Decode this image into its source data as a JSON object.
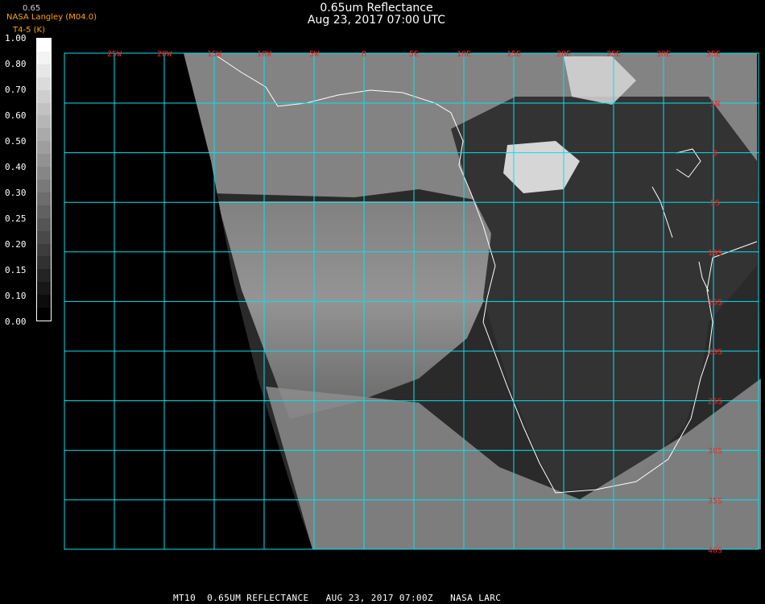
{
  "header": {
    "title": "0.65um Reflectance",
    "subtitle": "Aug 23, 2017 07:00 UTC"
  },
  "credit": {
    "band_label": "0.65",
    "source": "NASA Langley (M04.0)",
    "band_sub": "T4-5 (K)"
  },
  "colorbar": {
    "ticks": [
      "1.00",
      "0.80",
      "0.70",
      "0.60",
      "0.50",
      "0.40",
      "0.30",
      "0.25",
      "0.20",
      "0.15",
      "0.10",
      "0.00"
    ]
  },
  "map": {
    "lon_labels": [
      "25W",
      "20W",
      "15W",
      "10W",
      "5W",
      "0",
      "5E",
      "10E",
      "15E",
      "20E",
      "25E",
      "30E",
      "35E"
    ],
    "lat_labels": [
      "5N",
      "0",
      "5S",
      "10S",
      "15S",
      "20S",
      "25S",
      "30S",
      "35S",
      "40S"
    ],
    "grid_color": "#00e5ee",
    "label_color": "#ff2020",
    "coast_color": "#ffffff"
  },
  "footer": {
    "text": "MT10  0.65UM REFLECTANCE   AUG 23, 2017 07:00Z   NASA LARC"
  }
}
